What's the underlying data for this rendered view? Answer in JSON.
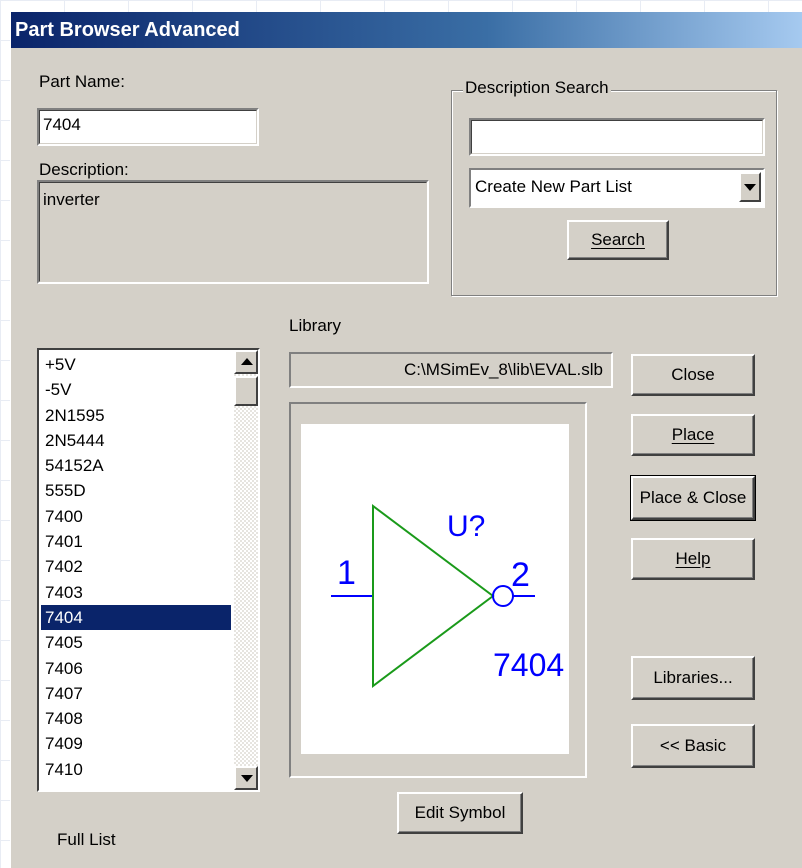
{
  "window": {
    "title": "Part Browser Advanced"
  },
  "part_name": {
    "label": "Part Name:",
    "value": "7404"
  },
  "description": {
    "label": "Description:",
    "value": "inverter"
  },
  "description_search": {
    "group_title": "Description Search",
    "input_value": "",
    "combo_selected": "Create New Part List",
    "search_button": "Search"
  },
  "library": {
    "label": "Library",
    "path": "C:\\MSimEv_8\\lib\\EVAL.slb"
  },
  "parts_list": {
    "items": [
      "+5V",
      "-5V",
      "2N1595",
      "2N5444",
      "54152A",
      "555D",
      "7400",
      "7401",
      "7402",
      "7403",
      "7404",
      "7405",
      "7406",
      "7407",
      "7408",
      "7409",
      "7410"
    ],
    "selected": "7404",
    "footer_label": "Full List"
  },
  "buttons": {
    "close": "Close",
    "place": "Place",
    "place_close": "Place & Close",
    "help": "Help",
    "libraries": "Libraries...",
    "basic": "<< Basic",
    "edit_symbol": "Edit Symbol"
  },
  "symbol": {
    "refdes": "U?",
    "pin_in": "1",
    "pin_out": "2",
    "part_value": "7404",
    "body_color": "#1a9a1a",
    "text_color": "#0000ff"
  }
}
